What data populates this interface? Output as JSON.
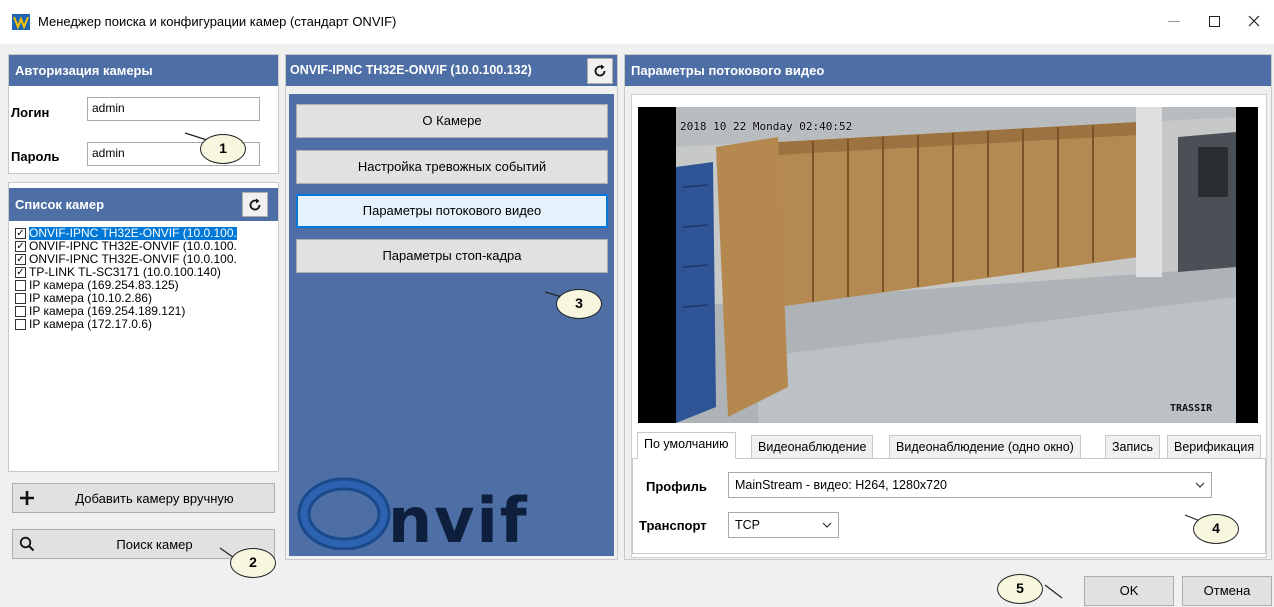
{
  "window": {
    "title": "Менеджер поиска и конфигурации камер (стандарт ONVIF)"
  },
  "auth": {
    "header": "Авторизация камеры",
    "login_label": "Логин",
    "login_value": "admin",
    "password_label": "Пароль",
    "password_value": "admin"
  },
  "camera_list": {
    "header": "Список камер",
    "items": [
      {
        "label": "ONVIF-IPNC TH32E-ONVIF (10.0.100.",
        "checked": true,
        "selected": true
      },
      {
        "label": "ONVIF-IPNC TH32E-ONVIF (10.0.100.",
        "checked": true
      },
      {
        "label": "ONVIF-IPNC TH32E-ONVIF (10.0.100.",
        "checked": true
      },
      {
        "label": "TP-LINK TL-SC3171 (10.0.100.140)",
        "checked": true
      },
      {
        "label": "IP камера (169.254.83.125)",
        "checked": false
      },
      {
        "label": "IP камера (10.10.2.86)",
        "checked": false
      },
      {
        "label": "IP камера (169.254.189.121)",
        "checked": false
      },
      {
        "label": "IP камера (172.17.0.6)",
        "checked": false
      }
    ],
    "add_button": "Добавить камеру вручную",
    "search_button": "Поиск камер"
  },
  "camera_menu": {
    "header": "ONVIF-IPNC TH32E-ONVIF (10.0.100.132)",
    "buttons": [
      "О Камере",
      "Настройка тревожных событий",
      "Параметры потокового видео",
      "Параметры стоп-кадра"
    ],
    "active_button": "Параметры потокового видео",
    "logo_text": "ONVIF"
  },
  "stream": {
    "header": "Параметры потокового видео",
    "osd_text": "2018 10 22  Monday  02:40:52",
    "watermark": "TRASSIR",
    "tabs": [
      "По умолчанию",
      "Видеонаблюдение",
      "Видеонаблюдение (одно окно)",
      "Запись",
      "Верификация"
    ],
    "active_tab": "По умолчанию",
    "profile_label": "Профиль",
    "profile_value": "MainStream - видео: H264, 1280x720",
    "transport_label": "Транспорт",
    "transport_value": "TCP"
  },
  "dialog": {
    "ok": "OK",
    "cancel": "Отмена"
  },
  "callouts": [
    "1",
    "2",
    "3",
    "4",
    "5"
  ],
  "colors": {
    "header_bg": "#4d6fa6",
    "selection": "#0078d7"
  }
}
